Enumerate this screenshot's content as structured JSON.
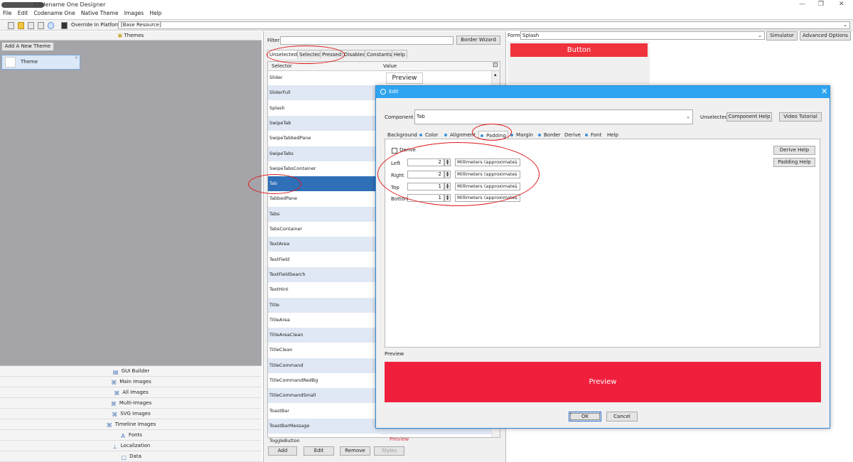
{
  "window": {
    "title": "Codename One Designer"
  },
  "menu": [
    "File",
    "Edit",
    "Codename One",
    "Native Theme",
    "Images",
    "Help"
  ],
  "toolbar": {
    "platform_label": "Override In Platform:",
    "platform_value": "[Base Resource]"
  },
  "themes": {
    "header": "Themes",
    "add_button": "Add A New Theme",
    "items": [
      {
        "label": "Theme"
      }
    ]
  },
  "nav": [
    {
      "label": "GUI Builder",
      "icon": "gui-builder-icon"
    },
    {
      "label": "Main Images",
      "icon": "images-icon"
    },
    {
      "label": "All Images",
      "icon": "images-icon"
    },
    {
      "label": "Multi-Images",
      "icon": "images-icon"
    },
    {
      "label": "SVG Images",
      "icon": "images-icon"
    },
    {
      "label": "Timeline Images",
      "icon": "images-icon"
    },
    {
      "label": "Fonts",
      "icon": "font-icon"
    },
    {
      "label": "Localization",
      "icon": "pin-icon"
    },
    {
      "label": "Data",
      "icon": "data-icon"
    }
  ],
  "styles": {
    "filter_label": "Filter:",
    "border_wizard": "Border Wizard",
    "tabs": [
      "Unselected",
      "Selected",
      "Pressed",
      "Disabled",
      "Constants",
      "Help"
    ],
    "active_tab": "Unselected",
    "columns": [
      "Selector",
      "Value"
    ],
    "rows": [
      "Slider",
      "SliderFull",
      "Splash",
      "SwipeTab",
      "SwipeTabbedPane",
      "SwipeTabs",
      "SwipeTabsContainer",
      "Tab",
      "TabbedPane",
      "Tabs",
      "TabsContainer",
      "TextArea",
      "TextField",
      "TextFieldSearch",
      "TextHint",
      "Title",
      "TitleArea",
      "TitleAreaClean",
      "TitleClean",
      "TitleCommand",
      "TitleCommandRedBg",
      "TitleCommandSmall",
      "ToastBar",
      "ToastBarMessage",
      "ToggleButton"
    ],
    "selected_row": "Tab",
    "preview_text": "Preview",
    "buttons": {
      "add": "Add",
      "edit": "Edit",
      "remove": "Remove",
      "styles": "Styles"
    }
  },
  "form": {
    "label": "Form:",
    "value": "Splash",
    "simulator": "Simulator",
    "advanced": "Advanced Options",
    "button_text": "Button"
  },
  "dialog": {
    "title": "Edit",
    "component_label": "Component",
    "component_value": "Tab",
    "state": "Unselected",
    "component_help": "Component Help",
    "video_tutorial": "Video Tutorial",
    "tabs": [
      "Background",
      "Color",
      "Alignment",
      "Padding",
      "Margin",
      "Border",
      "Derive",
      "Font",
      "Help"
    ],
    "active_tab": "Padding",
    "derive_label": "Derive",
    "padding": [
      {
        "label": "Left",
        "value": "2",
        "unit": "Millimeters (approximate)"
      },
      {
        "label": "Right",
        "value": "2",
        "unit": "Millimeters (approximate)"
      },
      {
        "label": "Top",
        "value": "1",
        "unit": "Millimeters (approximate)"
      },
      {
        "label": "Bottom",
        "value": "1",
        "unit": "Millimeters (approximate)"
      }
    ],
    "derive_help": "Derive Help",
    "padding_help": "Padding Help",
    "preview_label": "Preview",
    "preview_text": "Preview",
    "ok": "OK",
    "cancel": "Cancel"
  },
  "colors": {
    "accent": "#2ea4f0",
    "preview_red": "#f0203d",
    "selection": "#2f6fb8",
    "annotation": "#e01818"
  }
}
